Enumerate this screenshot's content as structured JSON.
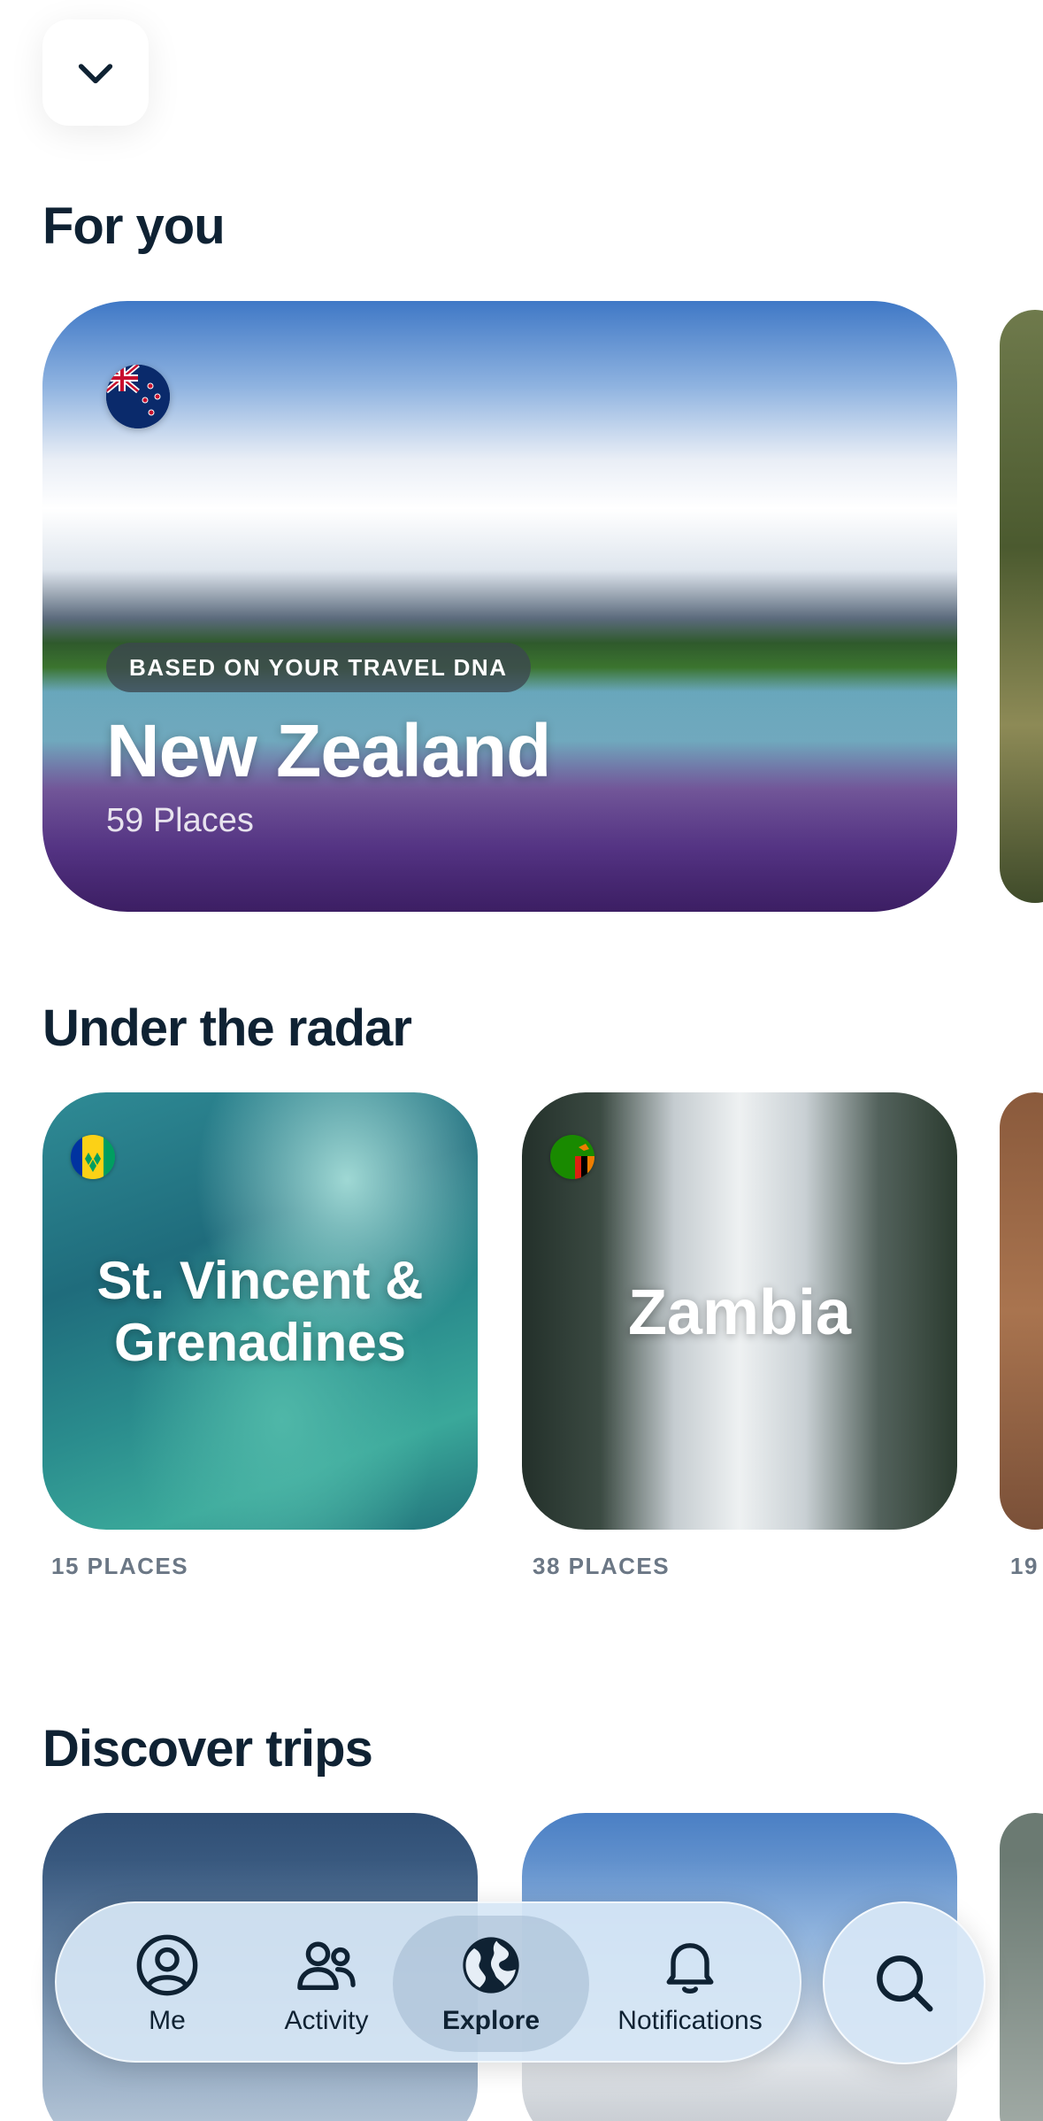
{
  "sections": {
    "for_you": {
      "title": "For you",
      "card": {
        "badge": "BASED ON YOUR TRAVEL DNA",
        "name": "New Zealand",
        "places": "59 Places",
        "flag_icon": "new-zealand-flag"
      }
    },
    "under_radar": {
      "title": "Under the radar",
      "cards": [
        {
          "name": "St. Vincent & Grenadines",
          "name_line1": "St. Vincent &",
          "name_line2": "Grenadines",
          "places": "15 PLACES",
          "flag_icon": "st-vincent-flag"
        },
        {
          "name": "Zambia",
          "places": "38 PLACES",
          "flag_icon": "zambia-flag"
        },
        {
          "places": "19"
        }
      ]
    },
    "discover_trips": {
      "title": "Discover trips"
    }
  },
  "tab_bar": {
    "items": [
      {
        "label": "Me",
        "icon": "person-icon"
      },
      {
        "label": "Activity",
        "icon": "people-icon"
      },
      {
        "label": "Explore",
        "icon": "globe-icon",
        "active": true
      },
      {
        "label": "Notifications",
        "icon": "bell-icon"
      }
    ]
  },
  "colors": {
    "text_primary": "#0f2233",
    "muted": "#6b7785",
    "tab_bar_bg": "#d6e6f5"
  }
}
